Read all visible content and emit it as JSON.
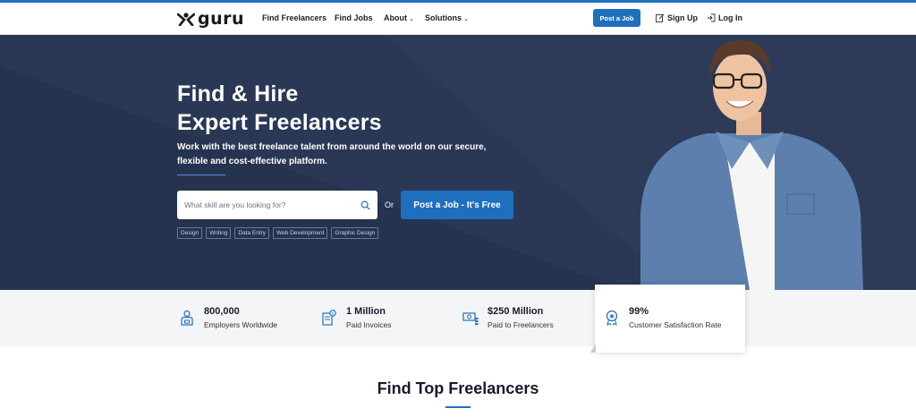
{
  "brand": {
    "logo_text": "guru"
  },
  "nav": {
    "items": [
      "Find Freelancers",
      "Find Jobs",
      "About",
      "Solutions"
    ],
    "post_job": "Post a Job",
    "sign_up": "Sign Up",
    "log_in": "Log In"
  },
  "hero": {
    "title_line1": "Find & Hire",
    "title_line2": "Expert Freelancers",
    "subtitle_line1": "Work with the best freelance talent from around the world on our secure,",
    "subtitle_line2": "flexible and cost-effective platform.",
    "search_placeholder": "What skill are you looking for?",
    "or_text": "Or",
    "cta": "Post a Job - It's Free",
    "tags": [
      "Design",
      "Writing",
      "Data Entry",
      "Web Development",
      "Graphic Design"
    ]
  },
  "stats": [
    {
      "value": "800,000",
      "label": "Employers Worldwide",
      "icon": "employer-icon"
    },
    {
      "value": "1 Million",
      "label": "Paid Invoices",
      "icon": "invoice-icon"
    },
    {
      "value": "$250 Million",
      "label": "Paid to Freelancers",
      "icon": "money-icon"
    },
    {
      "value": "99%",
      "label": "Customer Satisfaction Rate",
      "icon": "award-icon"
    }
  ],
  "section": {
    "title": "Find Top Freelancers"
  },
  "colors": {
    "accent": "#1f6fbf",
    "hero_bg": "#26334f",
    "stats_bg": "#f4f5f7"
  }
}
